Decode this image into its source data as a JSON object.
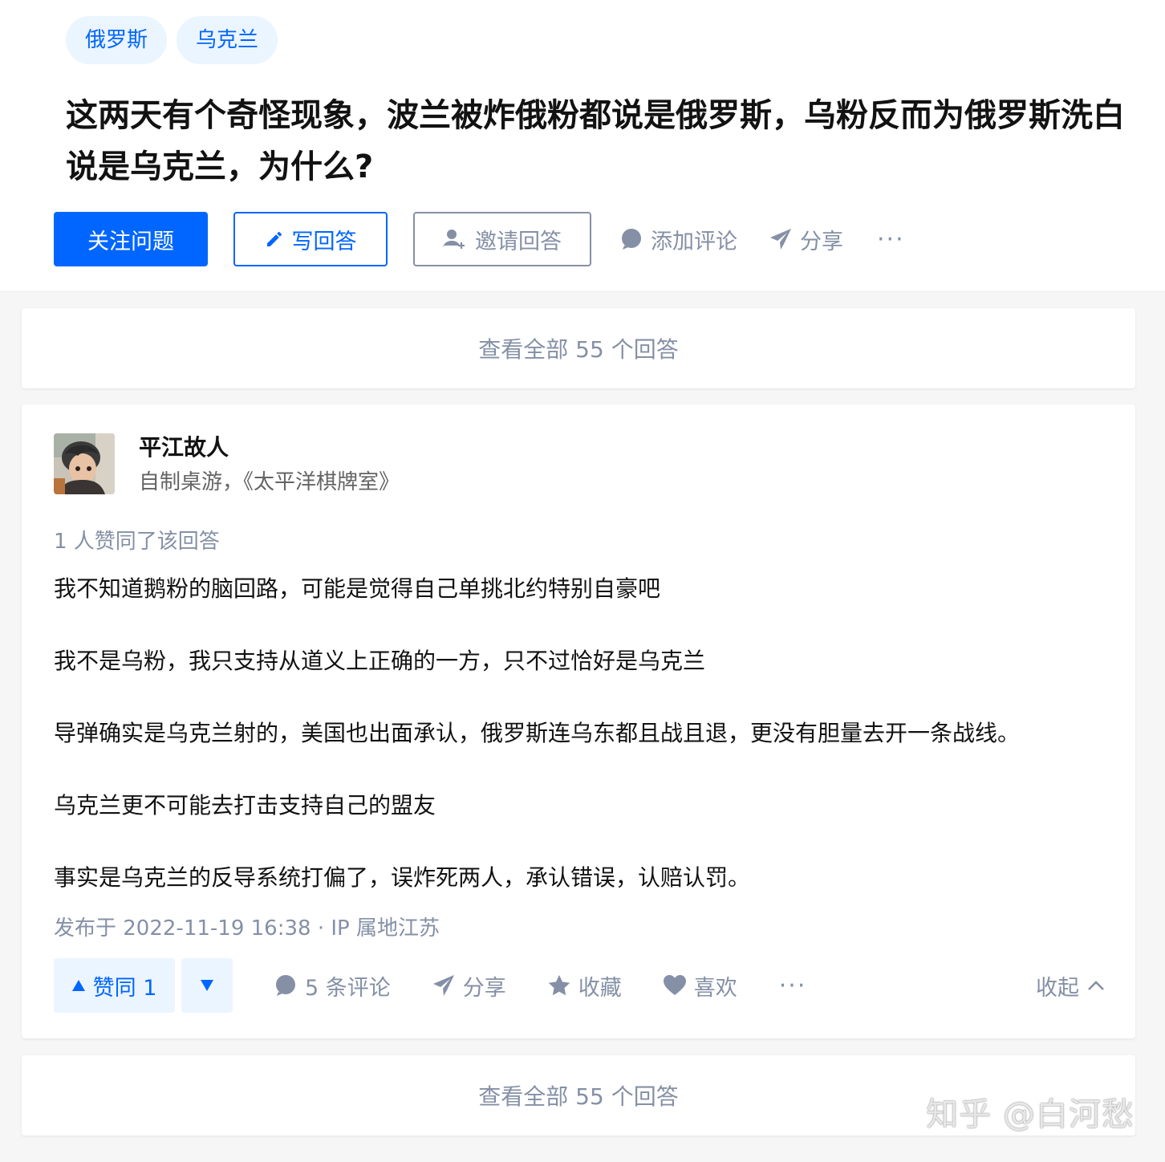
{
  "question": {
    "topics": [
      "俄罗斯",
      "乌克兰"
    ],
    "title": "这两天有个奇怪现象，波兰被炸俄粉都说是俄罗斯，乌粉反而为俄罗斯洗白说是乌克兰，为什么?",
    "actions": {
      "follow": "关注问题",
      "write": "写回答",
      "invite": "邀请回答",
      "comment": "添加评论",
      "share": "分享",
      "more": "···"
    }
  },
  "view_all": "查看全部 55 个回答",
  "answer": {
    "author": "平江故人",
    "headline": "自制桌游，《太平洋棋牌室》",
    "voters": "1 人赞同了该回答",
    "paragraphs": [
      "我不知道鹅粉的脑回路，可能是觉得自己单挑北约特别自豪吧",
      "我不是乌粉，我只支持从道义上正确的一方，只不过恰好是乌克兰",
      "导弹确实是乌克兰射的，美国也出面承认，俄罗斯连乌东都且战且退，更没有胆量去开一条战线。",
      "乌克兰更不可能去打击支持自己的盟友",
      "事实是乌克兰的反导系统打偏了，误炸死两人，承认错误，认赔认罚。"
    ],
    "meta": "发布于 2022-11-19 16:38 · IP 属地江苏",
    "actions": {
      "vote_up": "赞同 1",
      "comments": "5 条评论",
      "share": "分享",
      "collect": "收藏",
      "like": "喜欢",
      "more": "···",
      "collapse": "收起"
    }
  },
  "watermark": "知乎 @白河愁",
  "colors": {
    "brand": "#0066ff",
    "muted": "#8590a6",
    "tag_bg": "#ebf5ff"
  }
}
